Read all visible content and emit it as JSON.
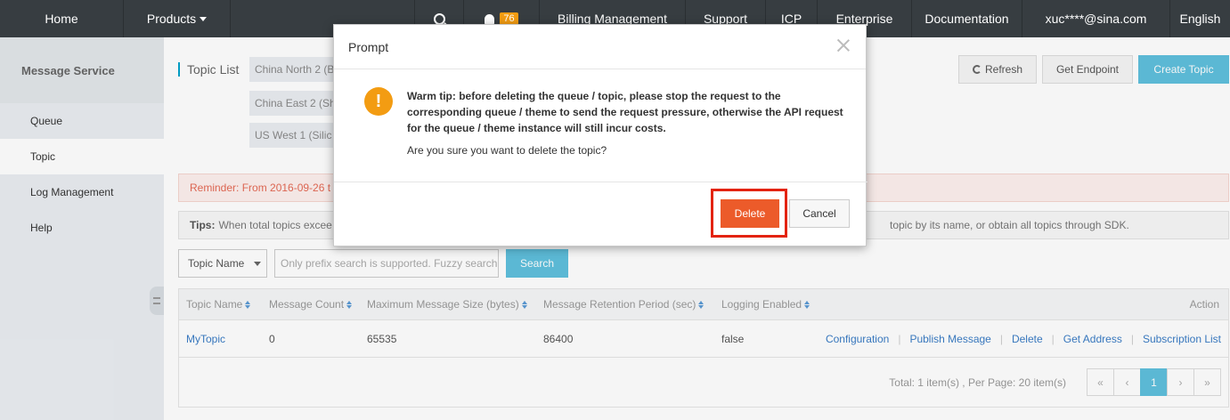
{
  "topbar": {
    "home": "Home",
    "products": "Products",
    "notification_count": "76",
    "billing": "Billing Management",
    "support": "Support",
    "icp": "ICP",
    "enterprise": "Enterprise",
    "documentation": "Documentation",
    "user": "xuc****@sina.com",
    "language": "English"
  },
  "sidebar": {
    "title": "Message Service",
    "items": [
      {
        "label": "Queue"
      },
      {
        "label": "Topic"
      },
      {
        "label": "Log Management"
      },
      {
        "label": "Help"
      }
    ],
    "active": "Topic"
  },
  "main": {
    "topic_list_label": "Topic List",
    "regions": [
      "China North 2 (B",
      "China East 2 (Sh",
      "US West 1 (Silic"
    ],
    "buttons": {
      "refresh": "Refresh",
      "get_endpoint": "Get Endpoint",
      "create_topic": "Create Topic"
    },
    "reminder": "Reminder: From 2016-09-26 t",
    "tips_label": "Tips:",
    "tips_text": "When total topics excee",
    "tips_tail": "topic by its name, or obtain all topics through SDK.",
    "filter": {
      "select_value": "Topic Name",
      "input_placeholder": "Only prefix search is supported. Fuzzy search",
      "search_button": "Search"
    },
    "table": {
      "columns": [
        "Topic Name",
        "Message Count",
        "Maximum Message Size (bytes)",
        "Message Retention Period (sec)",
        "Logging Enabled",
        "Action"
      ],
      "rows": [
        {
          "topic_name": "MyTopic",
          "message_count": "0",
          "max_message_size": "65535",
          "retention_period": "86400",
          "logging_enabled": "false",
          "actions": [
            "Configuration",
            "Publish Message",
            "Delete",
            "Get Address",
            "Subscription List"
          ]
        }
      ],
      "footer": "Total: 1 item(s) ,  Per Page: 20 item(s)",
      "pager": {
        "first": "«",
        "prev": "‹",
        "current": "1",
        "next": "›",
        "last": "»"
      }
    }
  },
  "modal": {
    "title": "Prompt",
    "warning": "Warm tip: before deleting the queue / topic, please stop the request to the corresponding queue / theme to send the request pressure, otherwise the API request for the queue / theme instance will still incur costs.",
    "question": "Are you sure you want to delete the topic?",
    "delete_label": "Delete",
    "cancel_label": "Cancel",
    "icon": "exclamation-icon"
  },
  "colors": {
    "topbar": "#373d41",
    "accent": "#5fc0dd",
    "delete": "#ec5b2a",
    "highlight": "#e3230f",
    "warning": "#f39c12",
    "link": "#3a7cc5"
  }
}
